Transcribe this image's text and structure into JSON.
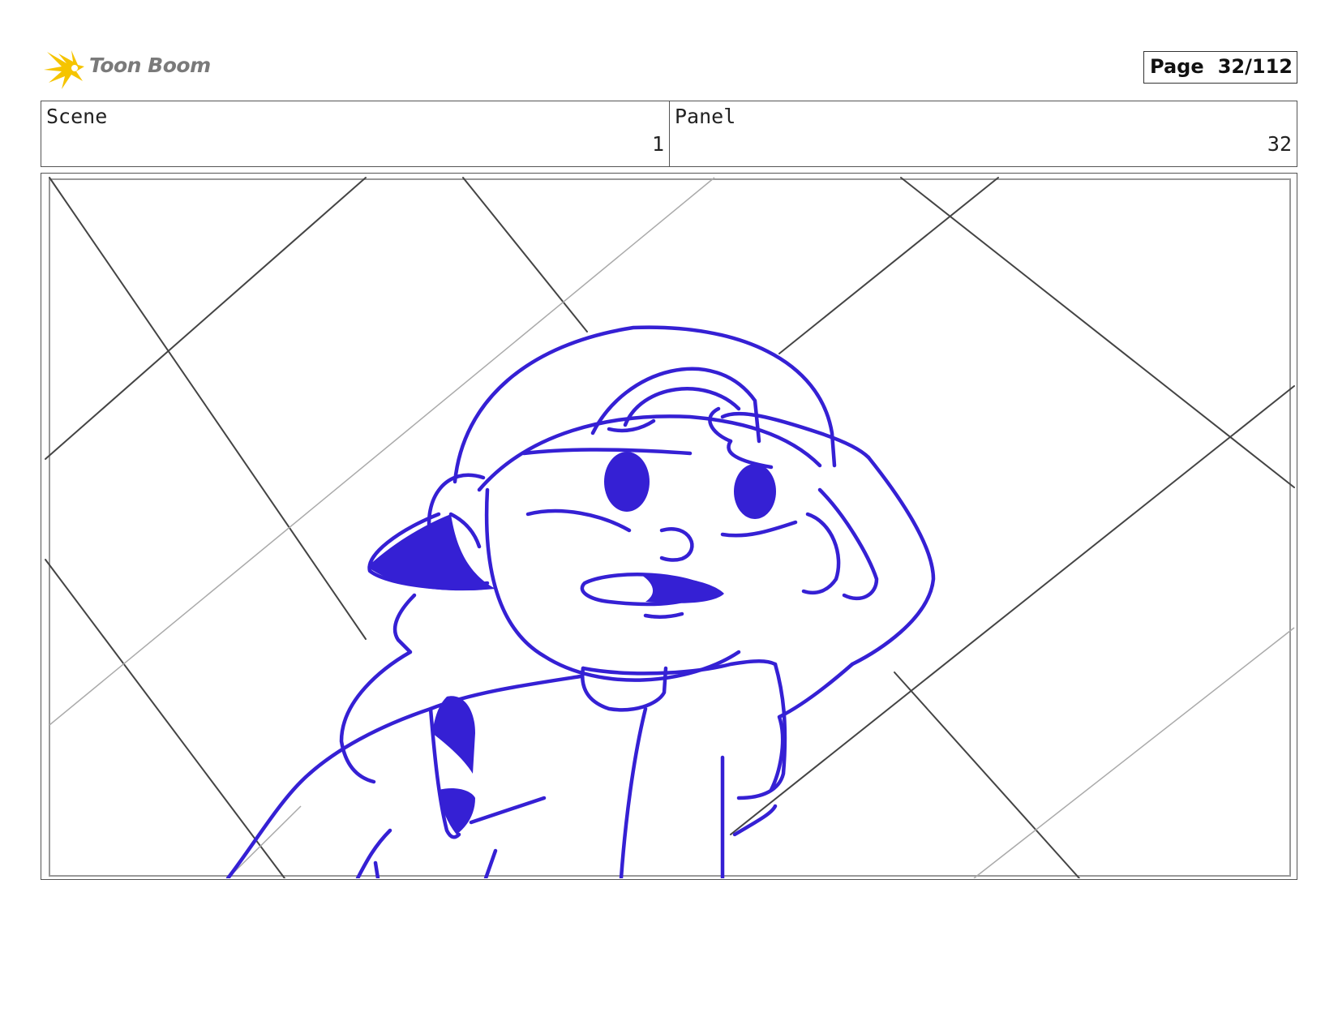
{
  "header": {
    "logo_text": "Toon Boom",
    "page_label": "Page",
    "page_number": "32/112"
  },
  "info": {
    "scene_label": "Scene",
    "scene_value": "1",
    "panel_label": "Panel",
    "panel_value": "32"
  },
  "colors": {
    "sketch_blue": "#3520d4",
    "grid_lines": "#444444",
    "logo_yellow": "#f5c400"
  },
  "panel_image": {
    "icon": "storyboard-sketch-character-saluting"
  }
}
